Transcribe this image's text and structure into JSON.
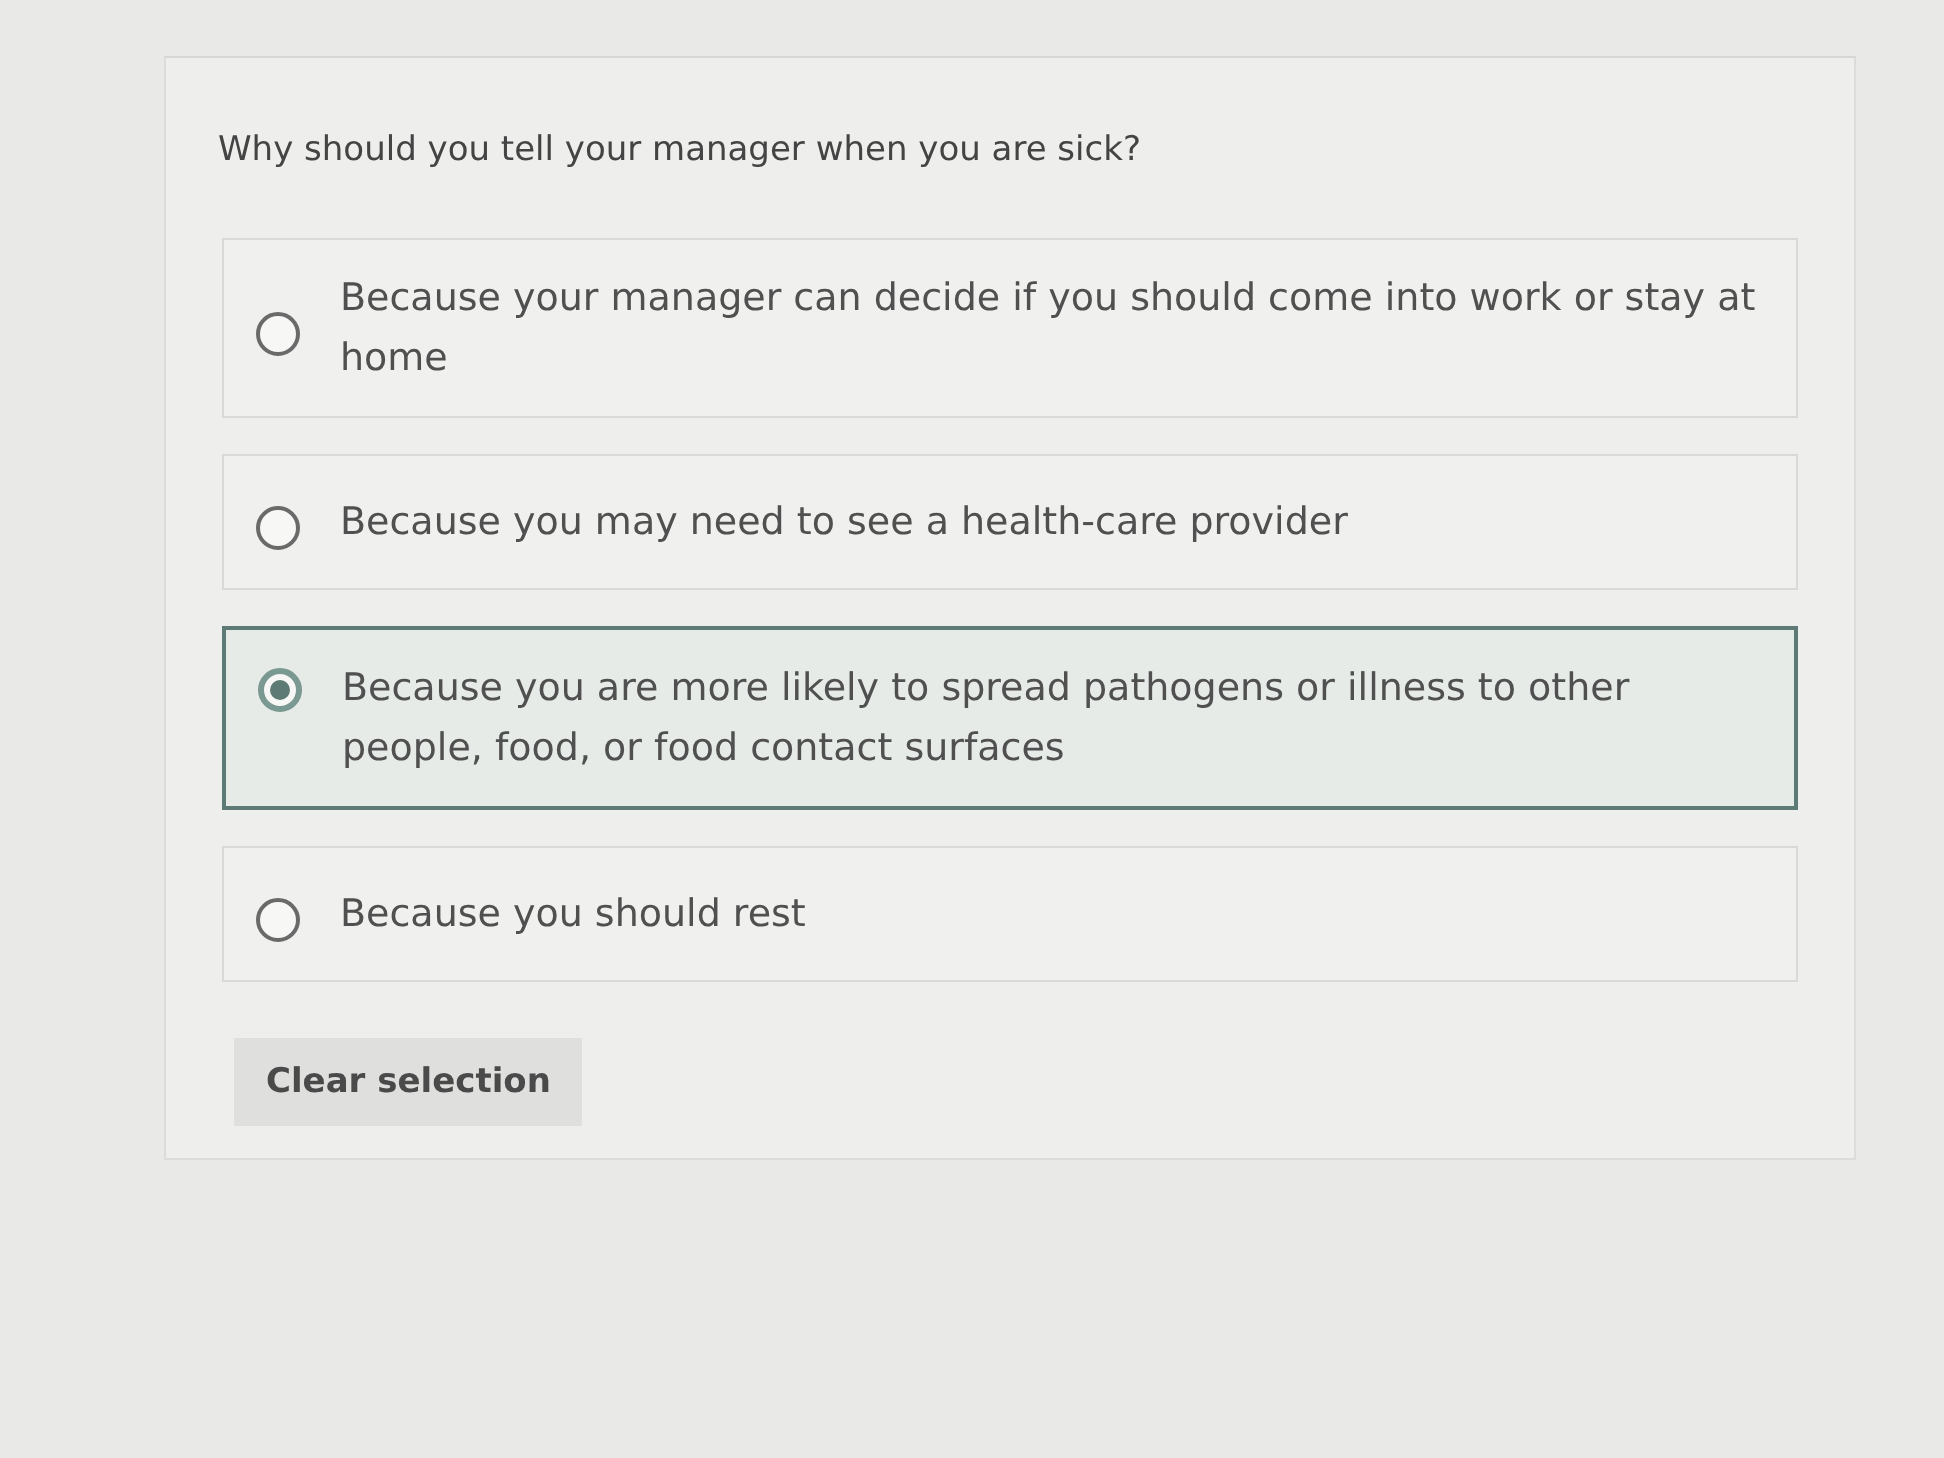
{
  "question": {
    "prompt": "Why should you tell your manager when you are sick?",
    "options": [
      {
        "label": "Because your manager can decide if you should come into work or stay at home",
        "selected": false
      },
      {
        "label": "Because you may need to see a health-care provider",
        "selected": false
      },
      {
        "label": "Because you are more likely to spread pathogens or illness to other people, food, or food contact surfaces",
        "selected": true
      },
      {
        "label": "Because you should rest",
        "selected": false
      }
    ],
    "clear_button": "Clear selection"
  }
}
